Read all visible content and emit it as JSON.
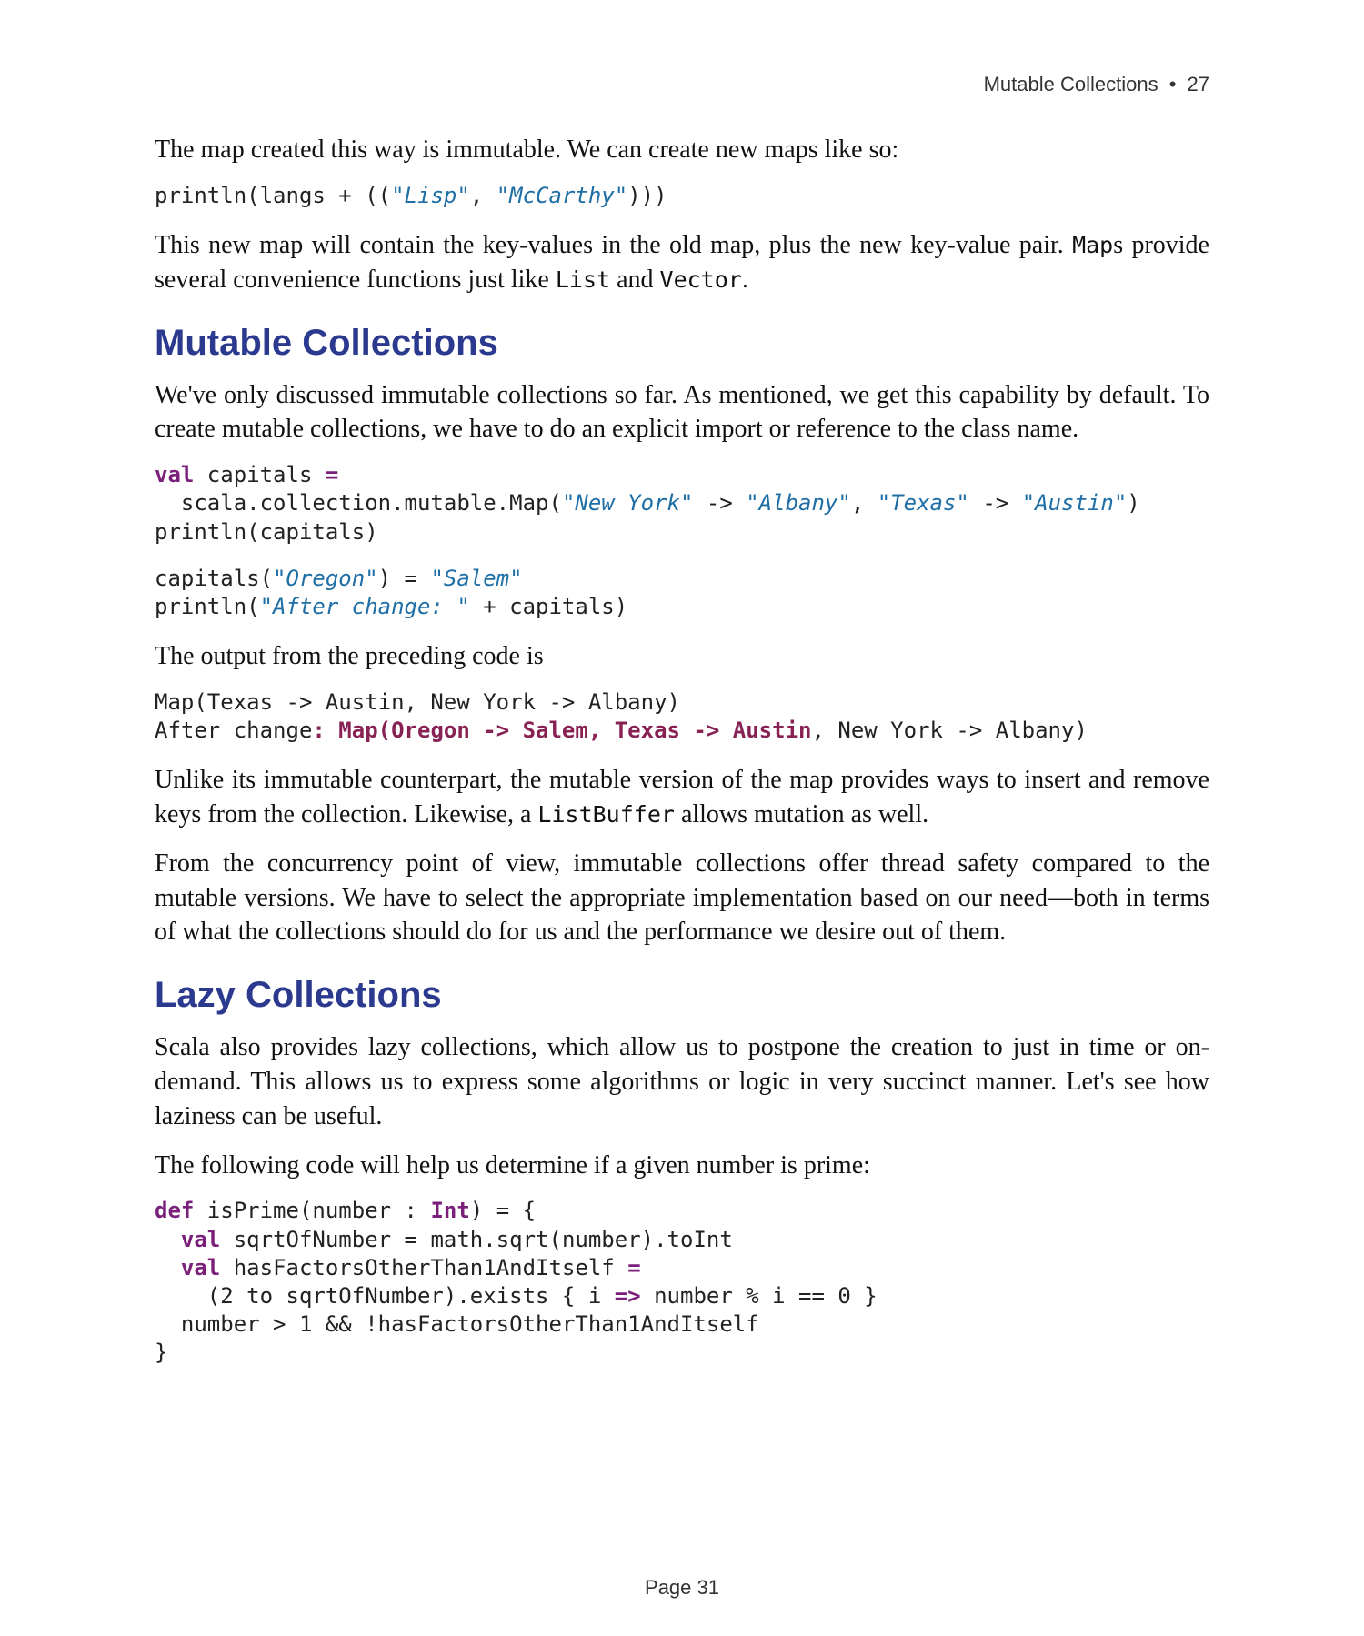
{
  "header": {
    "section": "Mutable Collections",
    "bullet": "•",
    "page_section_number": "27"
  },
  "para1": "The map created this way is immutable. We can create new maps like so:",
  "code1": {
    "pre": "println(langs + ((",
    "str1": "\"Lisp\"",
    "mid": ", ",
    "str2": "\"McCarthy\"",
    "post": ")))"
  },
  "para2_a": "This new map will contain the key-values in the old map, plus the new key-value pair. ",
  "para2_code1": "Map",
  "para2_b": "s provide several convenience functions just like ",
  "para2_code2": "List",
  "para2_c": " and ",
  "para2_code3": "Vector",
  "para2_d": ".",
  "heading1": "Mutable Collections",
  "para3": "We've only discussed immutable collections so far. As mentioned, we get this capability by default. To create mutable collections, we have to do an explicit import or reference to the class name.",
  "code2": {
    "kw_val": "val",
    "l1_a": " capitals ",
    "l1_eq": "=",
    "l2_a": "  scala.collection.mutable.Map(",
    "l2_s1": "\"New York\"",
    "l2_b": " -> ",
    "l2_s2": "\"Albany\"",
    "l2_c": ", ",
    "l2_s3": "\"Texas\"",
    "l2_d": " -> ",
    "l2_s4": "\"Austin\"",
    "l2_e": ")",
    "l3": "println(capitals)"
  },
  "code3": {
    "l1_a": "capitals(",
    "l1_s1": "\"Oregon\"",
    "l1_b": ") = ",
    "l1_s2": "\"Salem\"",
    "l2_a": "println(",
    "l2_s1": "\"After change: \"",
    "l2_b": " + capitals)"
  },
  "para4": "The output from the preceding code is",
  "code4": {
    "l1": "Map(Texas -> Austin, New York -> Albany)",
    "l2_a": "After change",
    "l2_colon": ": ",
    "l2_hl": "Map(Oregon -> Salem, Texas -> Austin",
    "l2_b": ", New York -> Albany)"
  },
  "para5_a": "Unlike its immutable counterpart, the mutable version of the map provides ways to insert and remove keys from the collection. Likewise, a ",
  "para5_code1": "ListBuffer",
  "para5_b": " allows mutation as well.",
  "para6": "From the concurrency point of view, immutable collections offer thread safety compared to the mutable versions. We have to select the appropriate implementation based on our need—both in terms of what the collections should do for us and the performance we desire out of them.",
  "heading2": "Lazy Collections",
  "para7": "Scala also provides lazy collections, which allow us to postpone the creation to just in time or on-demand. This allows us to express some algorithms or logic in very succinct manner. Let's see how laziness can be useful.",
  "para8": "The following code will help us determine if a given number is prime:",
  "code5": {
    "kw_def": "def",
    "l1_a": " isPrime(number : ",
    "typ_int": "Int",
    "l1_b": ") = {",
    "kw_val": "val",
    "l2_a": " sqrtOfNumber = math.sqrt(number).toInt",
    "l3_a": " hasFactorsOtherThan1AndItself ",
    "l3_eq": "=",
    "l4_a": "    (2 to sqrtOfNumber).exists { i ",
    "l4_arrow": "=>",
    "l4_b": " number % i == 0 }",
    "l5": "  number > 1 && !hasFactorsOtherThan1AndItself",
    "l6": "}"
  },
  "footer": "Page 31"
}
